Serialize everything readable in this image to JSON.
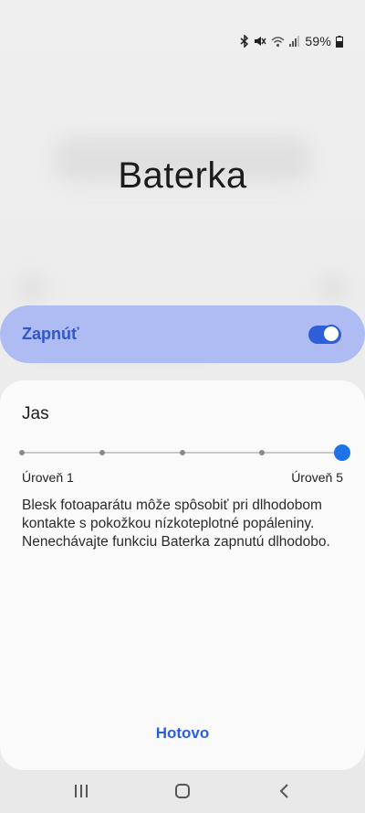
{
  "status_bar": {
    "battery_percent": "59%",
    "icons": [
      "bluetooth-icon",
      "mute-icon",
      "wifi-icon",
      "signal-icon",
      "battery-icon"
    ]
  },
  "dialog": {
    "title": "Baterka",
    "switch_label": "Zapnúť",
    "switch_on": true,
    "brightness_label": "Jas",
    "brightness_level_current": 5,
    "brightness_level_count": 5,
    "level_min_label": "Úroveň 1",
    "level_max_label": "Úroveň 5",
    "warning_text": "Blesk fotoaparátu môže spôsobiť pri dlhodobom kontakte s pokožkou nízkoteplotné popáleniny. Nenechávajte funkciu Baterka zapnutú dlhodobo.",
    "done_label": "Hotovo"
  },
  "nav_bar": {
    "icons": [
      "recent-apps-icon",
      "home-icon",
      "back-icon"
    ]
  },
  "colors": {
    "accent": "#2f5fd6",
    "switch_bar_bg": "#aebcf3",
    "slider_thumb": "#1e73e6"
  }
}
